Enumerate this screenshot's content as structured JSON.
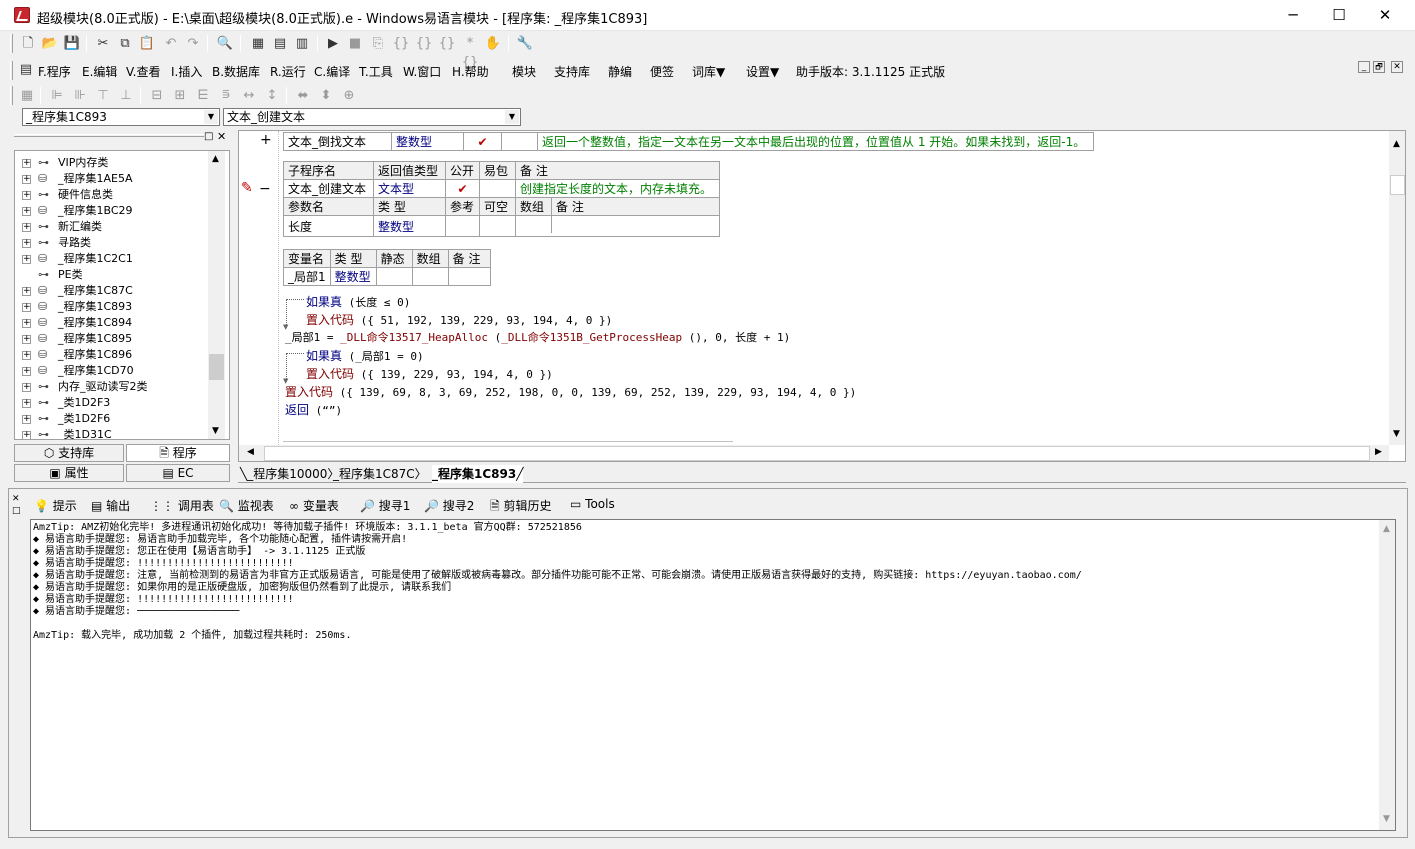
{
  "window": {
    "title": "超级模块(8.0正式版) - E:\\桌面\\超级模块(8.0正式版).e - Windows易语言模块 - [程序集: _程序集1C893]",
    "min_glyph": "─",
    "max_glyph": "☐",
    "close_glyph": "✕"
  },
  "menu": {
    "items": [
      "F.程序",
      "E.编辑",
      "V.查看",
      "I.插入",
      "B.数据库",
      "R.运行",
      "C.编译",
      "T.工具",
      "W.窗口",
      "H.帮助",
      "模块",
      "支持库",
      "静编",
      "便签",
      "词库▼",
      "设置▼",
      "助手版本: 3.1.1125 正式版"
    ],
    "mdi_buttons": [
      "_",
      "🗗",
      "✕"
    ]
  },
  "combos": {
    "left": "_程序集1C893",
    "right": "文本_创建文本"
  },
  "tree": {
    "items": [
      {
        "label": "VIP内存类",
        "icon": "class"
      },
      {
        "label": "_程序集1AE5A",
        "icon": "module"
      },
      {
        "label": "硬件信息类",
        "icon": "class"
      },
      {
        "label": "_程序集1BC29",
        "icon": "module"
      },
      {
        "label": "新汇编类",
        "icon": "class"
      },
      {
        "label": "寻路类",
        "icon": "class"
      },
      {
        "label": "_程序集1C2C1",
        "icon": "module"
      },
      {
        "label": "PE类",
        "icon": "class"
      },
      {
        "label": "_程序集1C87C",
        "icon": "module"
      },
      {
        "label": "_程序集1C893",
        "icon": "module"
      },
      {
        "label": "_程序集1C894",
        "icon": "module"
      },
      {
        "label": "_程序集1C895",
        "icon": "module"
      },
      {
        "label": "_程序集1C896",
        "icon": "module"
      },
      {
        "label": "_程序集1CD70",
        "icon": "module"
      },
      {
        "label": "内存_驱动读写2类",
        "icon": "class"
      },
      {
        "label": "_类1D2F3",
        "icon": "class"
      },
      {
        "label": "_类1D2F6",
        "icon": "class"
      },
      {
        "label": "_类1D31C",
        "icon": "class"
      }
    ],
    "tabs": {
      "support_lib": "支持库",
      "program": "程序",
      "property": "属性",
      "ec": "EC"
    }
  },
  "editor": {
    "top_row": {
      "name": "文本_倒找文本",
      "type": "整数型",
      "public": "✔",
      "note": "返回一个整数值，指定一文本在另一文本中最后出现的位置，位置值从 1 开始。如果未找到，返回-1。",
      "toggle": "+"
    },
    "sub_header": [
      "子程序名",
      "返回值类型",
      "公开",
      "易包",
      "备 注"
    ],
    "sub_row": {
      "name": "文本_创建文本",
      "type": "文本型",
      "public": "✔",
      "note": "创建指定长度的文本，内存未填充。",
      "toggle": "−"
    },
    "param_header": [
      "参数名",
      "类 型",
      "参考",
      "可空",
      "数组",
      "备 注"
    ],
    "param_row": {
      "name": "长度",
      "type": "整数型"
    },
    "var_header": [
      "变量名",
      "类 型",
      "静态",
      "数组",
      "备 注"
    ],
    "var_row": {
      "name": "_局部1",
      "type": "整数型"
    },
    "code": {
      "l1_kw": "如果真",
      "l1_rest": "(长度 ≤ 0)",
      "l2_kw": "置入代码",
      "l2_rest": "({ 51, 192, 139, 229, 93, 194, 4, 0 })",
      "l3_a": "_局部1 = ",
      "l3_b": "_DLL命令13517_HeapAlloc",
      "l3_c": " (",
      "l3_d": "_DLL命令1351B_GetProcessHeap",
      "l3_e": " (), 0, 长度 + 1)",
      "l4_kw": "如果真",
      "l4_rest": "(_局部1 = 0)",
      "l5_kw": "置入代码",
      "l5_rest": "({ 139, 229, 93, 194, 4, 0 })",
      "l6_kw": "置入代码",
      "l6_rest": "({ 139, 69, 8, 3, 69, 252, 198, 0, 0, 139, 69, 252, 139, 229, 93, 194, 4, 0 })",
      "l7_kw": "返回",
      "l7_rest": "(“”)"
    }
  },
  "doc_tabs": [
    "_程序集10000",
    "_程序集1C87C",
    "_程序集1C893"
  ],
  "bottom_tabs": [
    "提示",
    "输出",
    "调用表",
    "监视表",
    "变量表",
    "搜寻1",
    "搜寻2",
    "剪辑历史",
    "Tools"
  ],
  "output": {
    "lines": [
      "AmzTip: AMZ初始化完毕!  多进程通讯初始化成功!  等待加载子插件!  环境版本: 3.1.1_beta 官方QQ群: 572521856",
      "◆ 易语言助手提醒您: 易语言助手加载完毕, 各个功能随心配置, 插件请按需开启!",
      "◆ 易语言助手提醒您: 您正在使用【易语言助手】 -> 3.1.1125 正式版",
      "◆ 易语言助手提醒您: !!!!!!!!!!!!!!!!!!!!!!!!!!",
      "◆ 易语言助手提醒您: 注意, 当前检测到的易语言为非官方正式版易语言, 可能是使用了破解版或被病毒篡改。部分插件功能可能不正常、可能会崩溃。请使用正版易语言获得最好的支持, 购买链接: https://eyuyan.taobao.com/",
      "◆ 易语言助手提醒您: 如果你用的是正版硬盘版, 加密狗版但仍然看到了此提示, 请联系我们",
      "◆ 易语言助手提醒您: !!!!!!!!!!!!!!!!!!!!!!!!!!",
      "◆ 易语言助手提醒您: ─────────────────",
      "",
      "AmzTip: 载入完毕, 成功加载 2 个插件, 加载过程共耗时: 250ms."
    ]
  }
}
